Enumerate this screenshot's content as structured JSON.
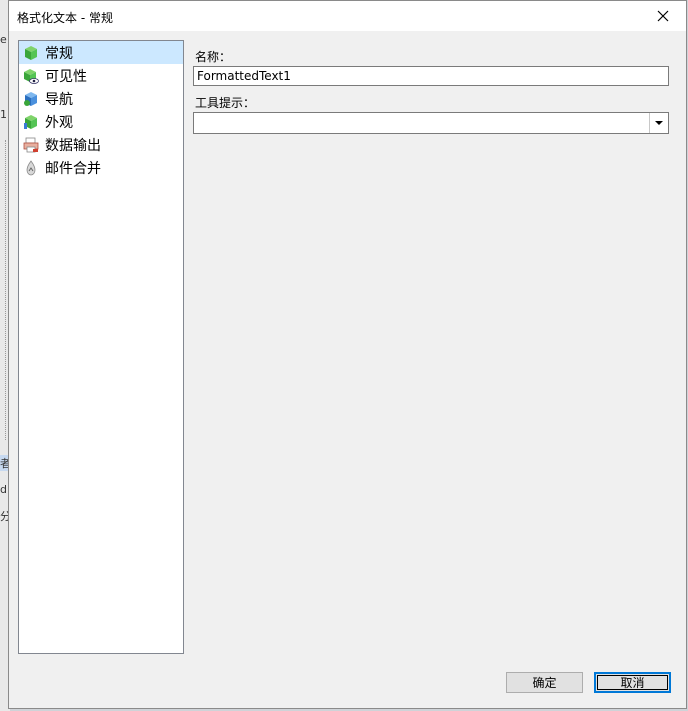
{
  "window": {
    "title": "格式化文本 - 常规",
    "close_glyph": "✕"
  },
  "sidebar": {
    "items": [
      {
        "label": "常规",
        "icon": "green-cube-icon",
        "selected": true
      },
      {
        "label": "可见性",
        "icon": "green-cube-eye-icon",
        "selected": false
      },
      {
        "label": "导航",
        "icon": "blue-cube-icon",
        "selected": false
      },
      {
        "label": "外观",
        "icon": "green-cube-brush-icon",
        "selected": false
      },
      {
        "label": "数据输出",
        "icon": "printer-icon",
        "selected": false
      },
      {
        "label": "邮件合并",
        "icon": "mail-merge-icon",
        "selected": false
      }
    ]
  },
  "form": {
    "name_label": "名称：",
    "name_value": "FormattedText1",
    "tooltip_label": "工具提示：",
    "tooltip_value": ""
  },
  "buttons": {
    "ok_label": "确定",
    "cancel_label": "取消"
  },
  "colors": {
    "selection": "#cce8ff",
    "accent": "#0078d7"
  }
}
